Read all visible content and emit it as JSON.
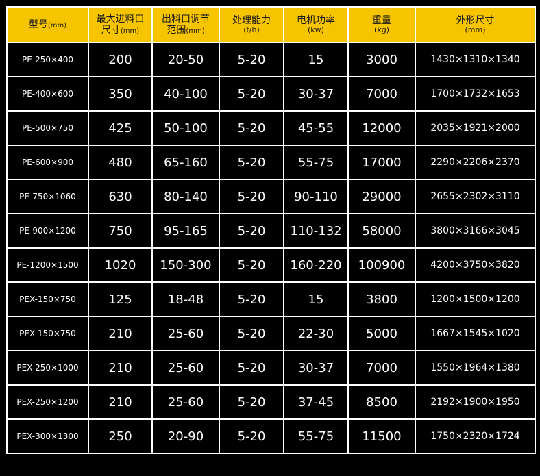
{
  "header": {
    "model": "型号",
    "model_unit": "(mm)",
    "feed_l1": "最大进料口",
    "feed_l2": "尺寸",
    "feed_unit": "(mm)",
    "outlet_l1": "出料口调节",
    "outlet_l2": "范围",
    "outlet_unit": "(mm)",
    "capacity": "处理能力",
    "capacity_unit": "(t/h)",
    "power": "电机功率",
    "power_unit": "(kw)",
    "weight": "重量",
    "weight_unit": "(kg)",
    "dims": "外形尺寸",
    "dims_unit": "(mm)"
  },
  "rows": [
    {
      "model": "PE-250×400",
      "feed": "200",
      "outlet": "20-50",
      "capacity": "5-20",
      "power": "15",
      "weight": "3000",
      "dims": "1430×1310×1340"
    },
    {
      "model": "PE-400×600",
      "feed": "350",
      "outlet": "40-100",
      "capacity": "5-20",
      "power": "30-37",
      "weight": "7000",
      "dims": "1700×1732×1653"
    },
    {
      "model": "PE-500×750",
      "feed": "425",
      "outlet": "50-100",
      "capacity": "5-20",
      "power": "45-55",
      "weight": "12000",
      "dims": "2035×1921×2000"
    },
    {
      "model": "PE-600×900",
      "feed": "480",
      "outlet": "65-160",
      "capacity": "5-20",
      "power": "55-75",
      "weight": "17000",
      "dims": "2290×2206×2370"
    },
    {
      "model": "PE-750×1060",
      "feed": "630",
      "outlet": "80-140",
      "capacity": "5-20",
      "power": "90-110",
      "weight": "29000",
      "dims": "2655×2302×3110"
    },
    {
      "model": "PE-900×1200",
      "feed": "750",
      "outlet": "95-165",
      "capacity": "5-20",
      "power": "110-132",
      "weight": "58000",
      "dims": "3800×3166×3045"
    },
    {
      "model": "PE-1200×1500",
      "feed": "1020",
      "outlet": "150-300",
      "capacity": "5-20",
      "power": "160-220",
      "weight": "100900",
      "dims": "4200×3750×3820"
    },
    {
      "model": "PEX-150×750",
      "feed": "125",
      "outlet": "18-48",
      "capacity": "5-20",
      "power": "15",
      "weight": "3800",
      "dims": "1200×1500×1200"
    },
    {
      "model": "PEX-150×750",
      "feed": "210",
      "outlet": "25-60",
      "capacity": "5-20",
      "power": "22-30",
      "weight": "5000",
      "dims": "1667×1545×1020"
    },
    {
      "model": "PEX-250×1000",
      "feed": "210",
      "outlet": "25-60",
      "capacity": "5-20",
      "power": "30-37",
      "weight": "7000",
      "dims": "1550×1964×1380"
    },
    {
      "model": "PEX-250×1200",
      "feed": "210",
      "outlet": "25-60",
      "capacity": "5-20",
      "power": "37-45",
      "weight": "8500",
      "dims": "2192×1900×1950"
    },
    {
      "model": "PEX-300×1300",
      "feed": "250",
      "outlet": "20-90",
      "capacity": "5-20",
      "power": "55-75",
      "weight": "11500",
      "dims": "1750×2320×1724"
    }
  ],
  "colors": {
    "header_bg": "#f7c400",
    "header_text": "#1a1a1a",
    "body_bg": "#000000",
    "body_text": "#ffffff",
    "grid_lines": "#ffffff"
  }
}
